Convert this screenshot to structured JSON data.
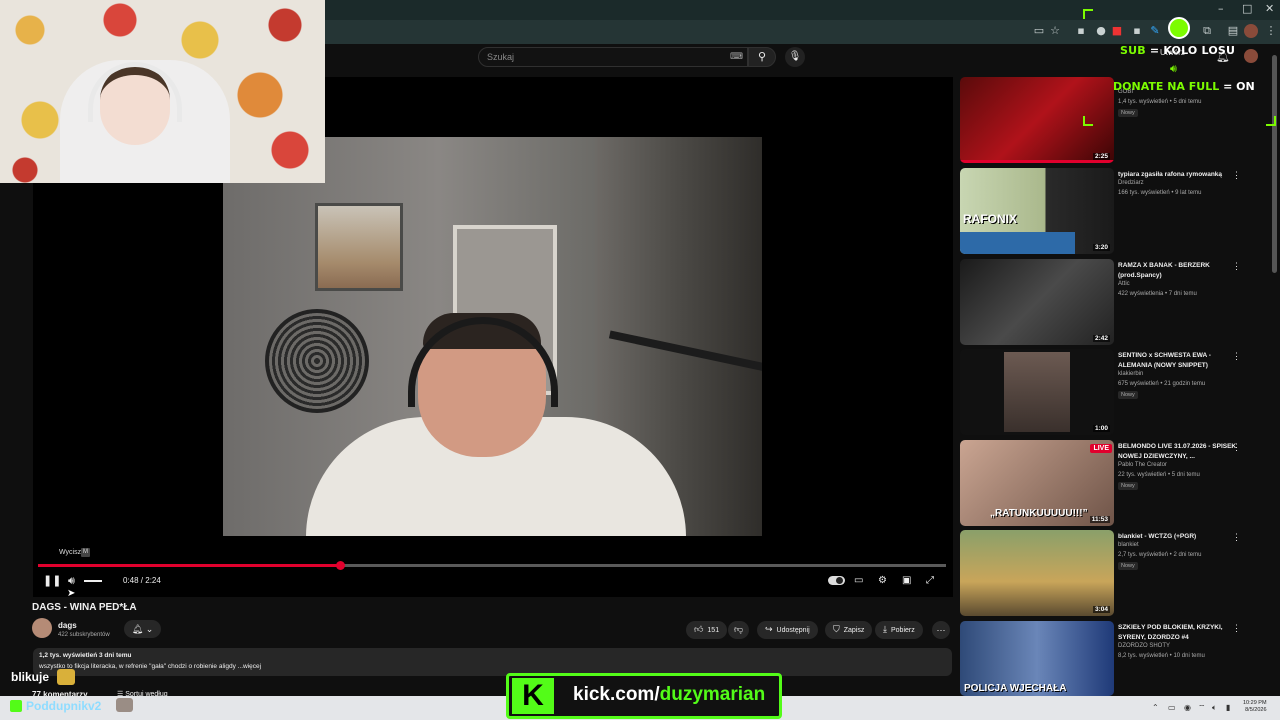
{
  "browser": {
    "window_controls": [
      "–",
      "□",
      "✕"
    ]
  },
  "header": {
    "search_placeholder": "Szukaj",
    "create_label": "Utwórz"
  },
  "overlay": {
    "sub_left": "SUB",
    "sub_eq": "=",
    "sub_right": "KOLO LOSU",
    "donate_left": "DONATE NA FULL",
    "donate_eq": "=",
    "donate_right": "ON",
    "accent": "#7CFC00"
  },
  "player": {
    "mute_tooltip": "Wycisz",
    "mute_key": "M",
    "time": "0:48 / 2:24",
    "progress_fraction": 0.333
  },
  "video": {
    "title": "DAGS - WINA PED*ŁA",
    "channel": "dags",
    "subscribers": "422 subskrybentów",
    "likes": "151",
    "share": "Udostępnij",
    "save": "Zapisz",
    "download": "Pobierz",
    "stats": "1,2 tys. wyświetleń  3 dni temu",
    "description": "wszystko to fikcja literacka, w refrenie \"gała\" chodzi o robienie aligdy ...więcej",
    "comments": "77 komentarzy",
    "sort": "Sortuj według"
  },
  "recommendations": [
    {
      "title": "",
      "channel": "GOBI",
      "meta": "1,4 tys. wyświetleń • 5 dni temu",
      "badge": "Nowy",
      "duration": "2:25"
    },
    {
      "title": "typiara zgasiła rafona rymowanką",
      "channel": "Dredziarz",
      "meta": "166 tys. wyświetleń • 9 lat temu",
      "badge": "",
      "duration": "3:20",
      "thumb_text": "RAFONIX"
    },
    {
      "title": "RAMZA X BANAK - BERZERK (prod.Spancy)",
      "channel": "Attic",
      "meta": "422 wyświetlenia • 7 dni temu",
      "badge": "",
      "duration": "2:42"
    },
    {
      "title": "SENTINO x SCHWESTA EWA - ALEMANIA (NOWY SNIPPET)",
      "channel": "klakierbin",
      "meta": "675 wyświetleń • 21 godzin temu",
      "badge": "Nowy",
      "duration": "1:00"
    },
    {
      "title": "BELMONDO LIVE 31.07.2026 - SPISEK NOWEJ DZIEWCZYNY, ...",
      "channel": "Pablo The Creator",
      "meta": "22 tys. wyświetleń • 5 dni temu",
      "badge": "Nowy",
      "duration": "11:53",
      "thumb_text": "„RATUNKUUUUU!!!”",
      "live": "LIVE"
    },
    {
      "title": "blankiet - WCTZG (+PGR)",
      "channel": "blankiet",
      "meta": "2,7 tys. wyświetleń • 2 dni temu",
      "badge": "Nowy",
      "duration": "3:04"
    },
    {
      "title": "SZKIEŁY POD BLOKIEM, KRZYKI, SYRENY, DZORDZO #4",
      "channel": "DZORDZO SHOTY",
      "meta": "8,2 tys. wyświetleń • 10 dni temu",
      "badge": "",
      "duration": "",
      "thumb_text": "POLICJA WJECHAŁA"
    }
  ],
  "chat": {
    "line1_user": "blikuje",
    "line2_user": "Poddupnikv2"
  },
  "kick": {
    "url_prefix": "kick.com/",
    "url_name": "duzymarian",
    "logo": "K"
  },
  "taskbar": {
    "time": "10:29 PM",
    "date": "8/5/2026"
  }
}
